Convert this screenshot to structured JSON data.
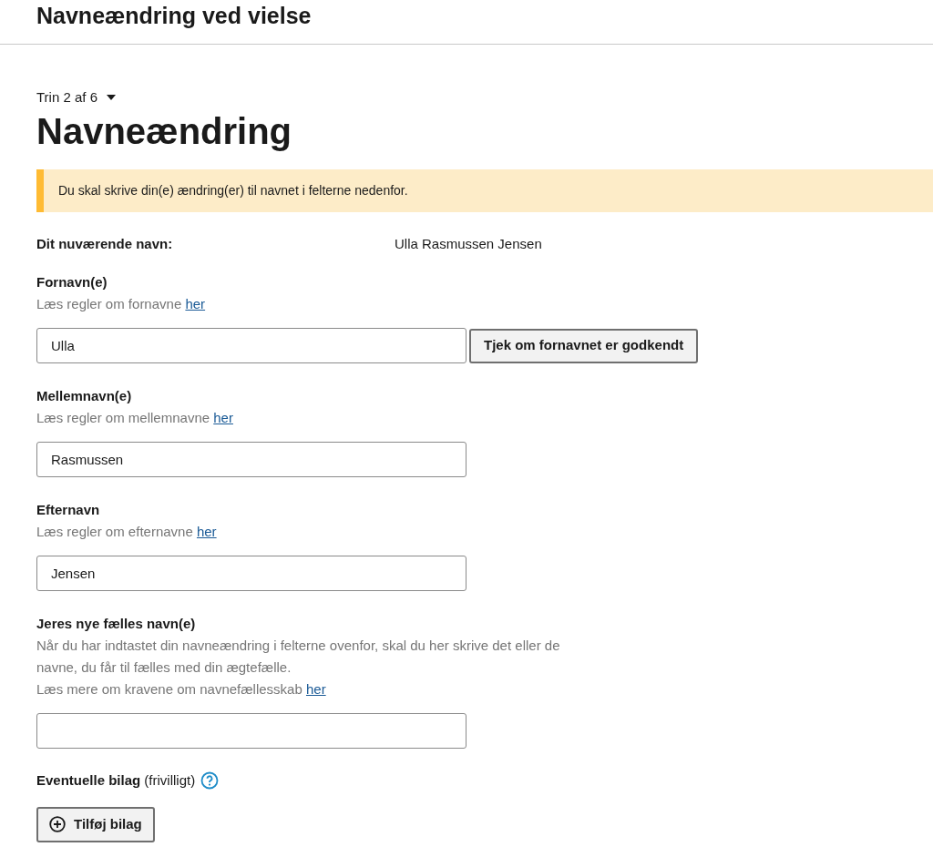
{
  "header": {
    "title": "Navneændring ved vielse"
  },
  "step": {
    "label": "Trin 2 af 6"
  },
  "heading": "Navneændring",
  "notice": "Du skal skrive din(e) ændring(er) til navnet i felterne nedenfor.",
  "current_name": {
    "label": "Dit nuværende navn:",
    "value": "Ulla Rasmussen Jensen"
  },
  "fields": [
    {
      "label": "Fornavn(e)",
      "hint": "Læs regler om fornavne",
      "link": "her",
      "value": "Ulla",
      "button": "Tjek om fornavnet er godkendt"
    },
    {
      "label": "Mellemnavn(e)",
      "hint": "Læs regler om mellemnavne",
      "link": "her",
      "value": "Rasmussen"
    },
    {
      "label": "Efternavn",
      "hint": "Læs regler om efternavne",
      "link": "her",
      "value": "Jensen"
    },
    {
      "label": "Jeres nye fælles navn(e)",
      "description": "Når du har indtastet din navneændring i felterne ovenfor, skal du her skrive det eller de navne, du får til fælles med din ægtefælle.",
      "hint": "Læs mere om kravene om navnefællesskab",
      "link": "her"
    }
  ],
  "attachments": {
    "label": "**Eventuelle bilag** (frivilligt)",
    "button": "Tilføj bilag"
  }
}
